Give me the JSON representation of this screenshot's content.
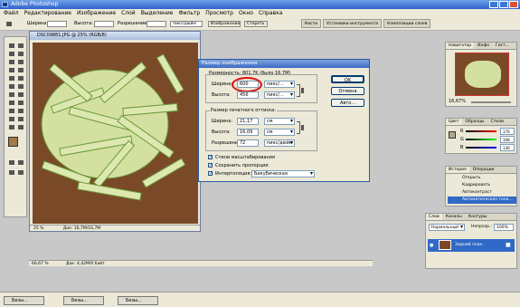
{
  "app": {
    "title": "Adobe Photoshop"
  },
  "menu": [
    "Файл",
    "Редактирование",
    "Изображение",
    "Слой",
    "Выделение",
    "Фильтр",
    "Просмотр",
    "Окно",
    "Справка"
  ],
  "options": {
    "width_label": "Ширина:",
    "height_label": "Высота:",
    "resolution_label": "Разрешение:",
    "resolution_unit": "пикс/дюйм",
    "front_image": "Изображение",
    "clear": "Стереть"
  },
  "right_tabs": [
    "Кисти",
    "Установки инструмента",
    "Композиции слоев"
  ],
  "document": {
    "title": "DSC09881.JPG @ 25% (RGB/8)",
    "zoom": "25 %",
    "doc_info": "Док: 16,7M/16,7M"
  },
  "main_status": {
    "zoom": "66,67 %",
    "doc_info": "Док: 4,42M/0 байт"
  },
  "dialog": {
    "title": "Размер изображения",
    "pixel_dims_label": "Размерность: 801,7K (было 16,7M)",
    "width_label": "Ширина:",
    "width_value": "600",
    "width_unit": "пикс/...",
    "height_label": "Высота:",
    "height_value": "456",
    "height_unit": "пикс/...",
    "print_group": "Размер печатного оттиска:",
    "pw_label": "Ширина:",
    "pw_value": "21,17",
    "pw_unit": "см",
    "ph_label": "Высота:",
    "ph_value": "16,09",
    "ph_unit": "см",
    "res_label": "Разрешение:",
    "res_value": "72",
    "res_unit": "пикс/дюйм",
    "chk_styles": "Стили масштабирования",
    "chk_proportions": "Сохранить пропорции",
    "chk_interp": "Интерполяция:",
    "interp_value": "Бикубическая",
    "ok": "OK",
    "cancel": "Отмена",
    "auto": "Авто..."
  },
  "navigator": {
    "tabs": [
      "Навигатор",
      "Инфо",
      "Гист..."
    ],
    "zoom": "16,67%"
  },
  "color": {
    "tabs": [
      "Цвет",
      "Образцы",
      "Стили"
    ],
    "channels": [
      {
        "name": "R",
        "value": "176"
      },
      {
        "name": "G",
        "value": "168"
      },
      {
        "name": "B",
        "value": "136"
      }
    ]
  },
  "history": {
    "tabs": [
      "История",
      "Операции"
    ],
    "items": [
      "Открыть",
      "Кадрировать",
      "Автоконтраст",
      "Автоматическая тоно..."
    ]
  },
  "layers": {
    "tabs": [
      "Слои",
      "Каналы",
      "Контуры"
    ],
    "blend": "Нормальный",
    "opacity_label": "Непрозр.:",
    "opacity": "100%",
    "layer_name": "Задний план"
  },
  "taskbar": [
    "Безы...",
    "Безы...",
    "Безы..."
  ],
  "colors": {
    "xp_blue": "#2e63c9",
    "photo_bg": "#7a4a28",
    "zucchini": "#dde8b0",
    "accent_red": "#dd1111"
  }
}
